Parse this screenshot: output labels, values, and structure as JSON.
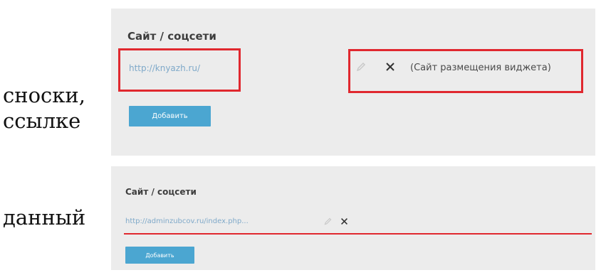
{
  "side_labels": {
    "line1": "сноски,",
    "line2": "ссылке",
    "line3": "данный"
  },
  "panel1": {
    "title": "Сайт / соцсети",
    "link": "http://knyazh.ru/",
    "note": "(Сайт размещения виджета)",
    "add_button": "Добавить"
  },
  "panel2": {
    "title": "Сайт / соцсети",
    "link": "http://adminzubcov.ru/index.php...",
    "add_button": "Добавить"
  },
  "icons": {
    "edit": "pencil-icon",
    "remove": "close-icon"
  },
  "colors": {
    "panel_bg": "#ececec",
    "button_bg": "#4ba6d1",
    "link": "#7fa9c9",
    "highlight_red": "#e0282f"
  }
}
